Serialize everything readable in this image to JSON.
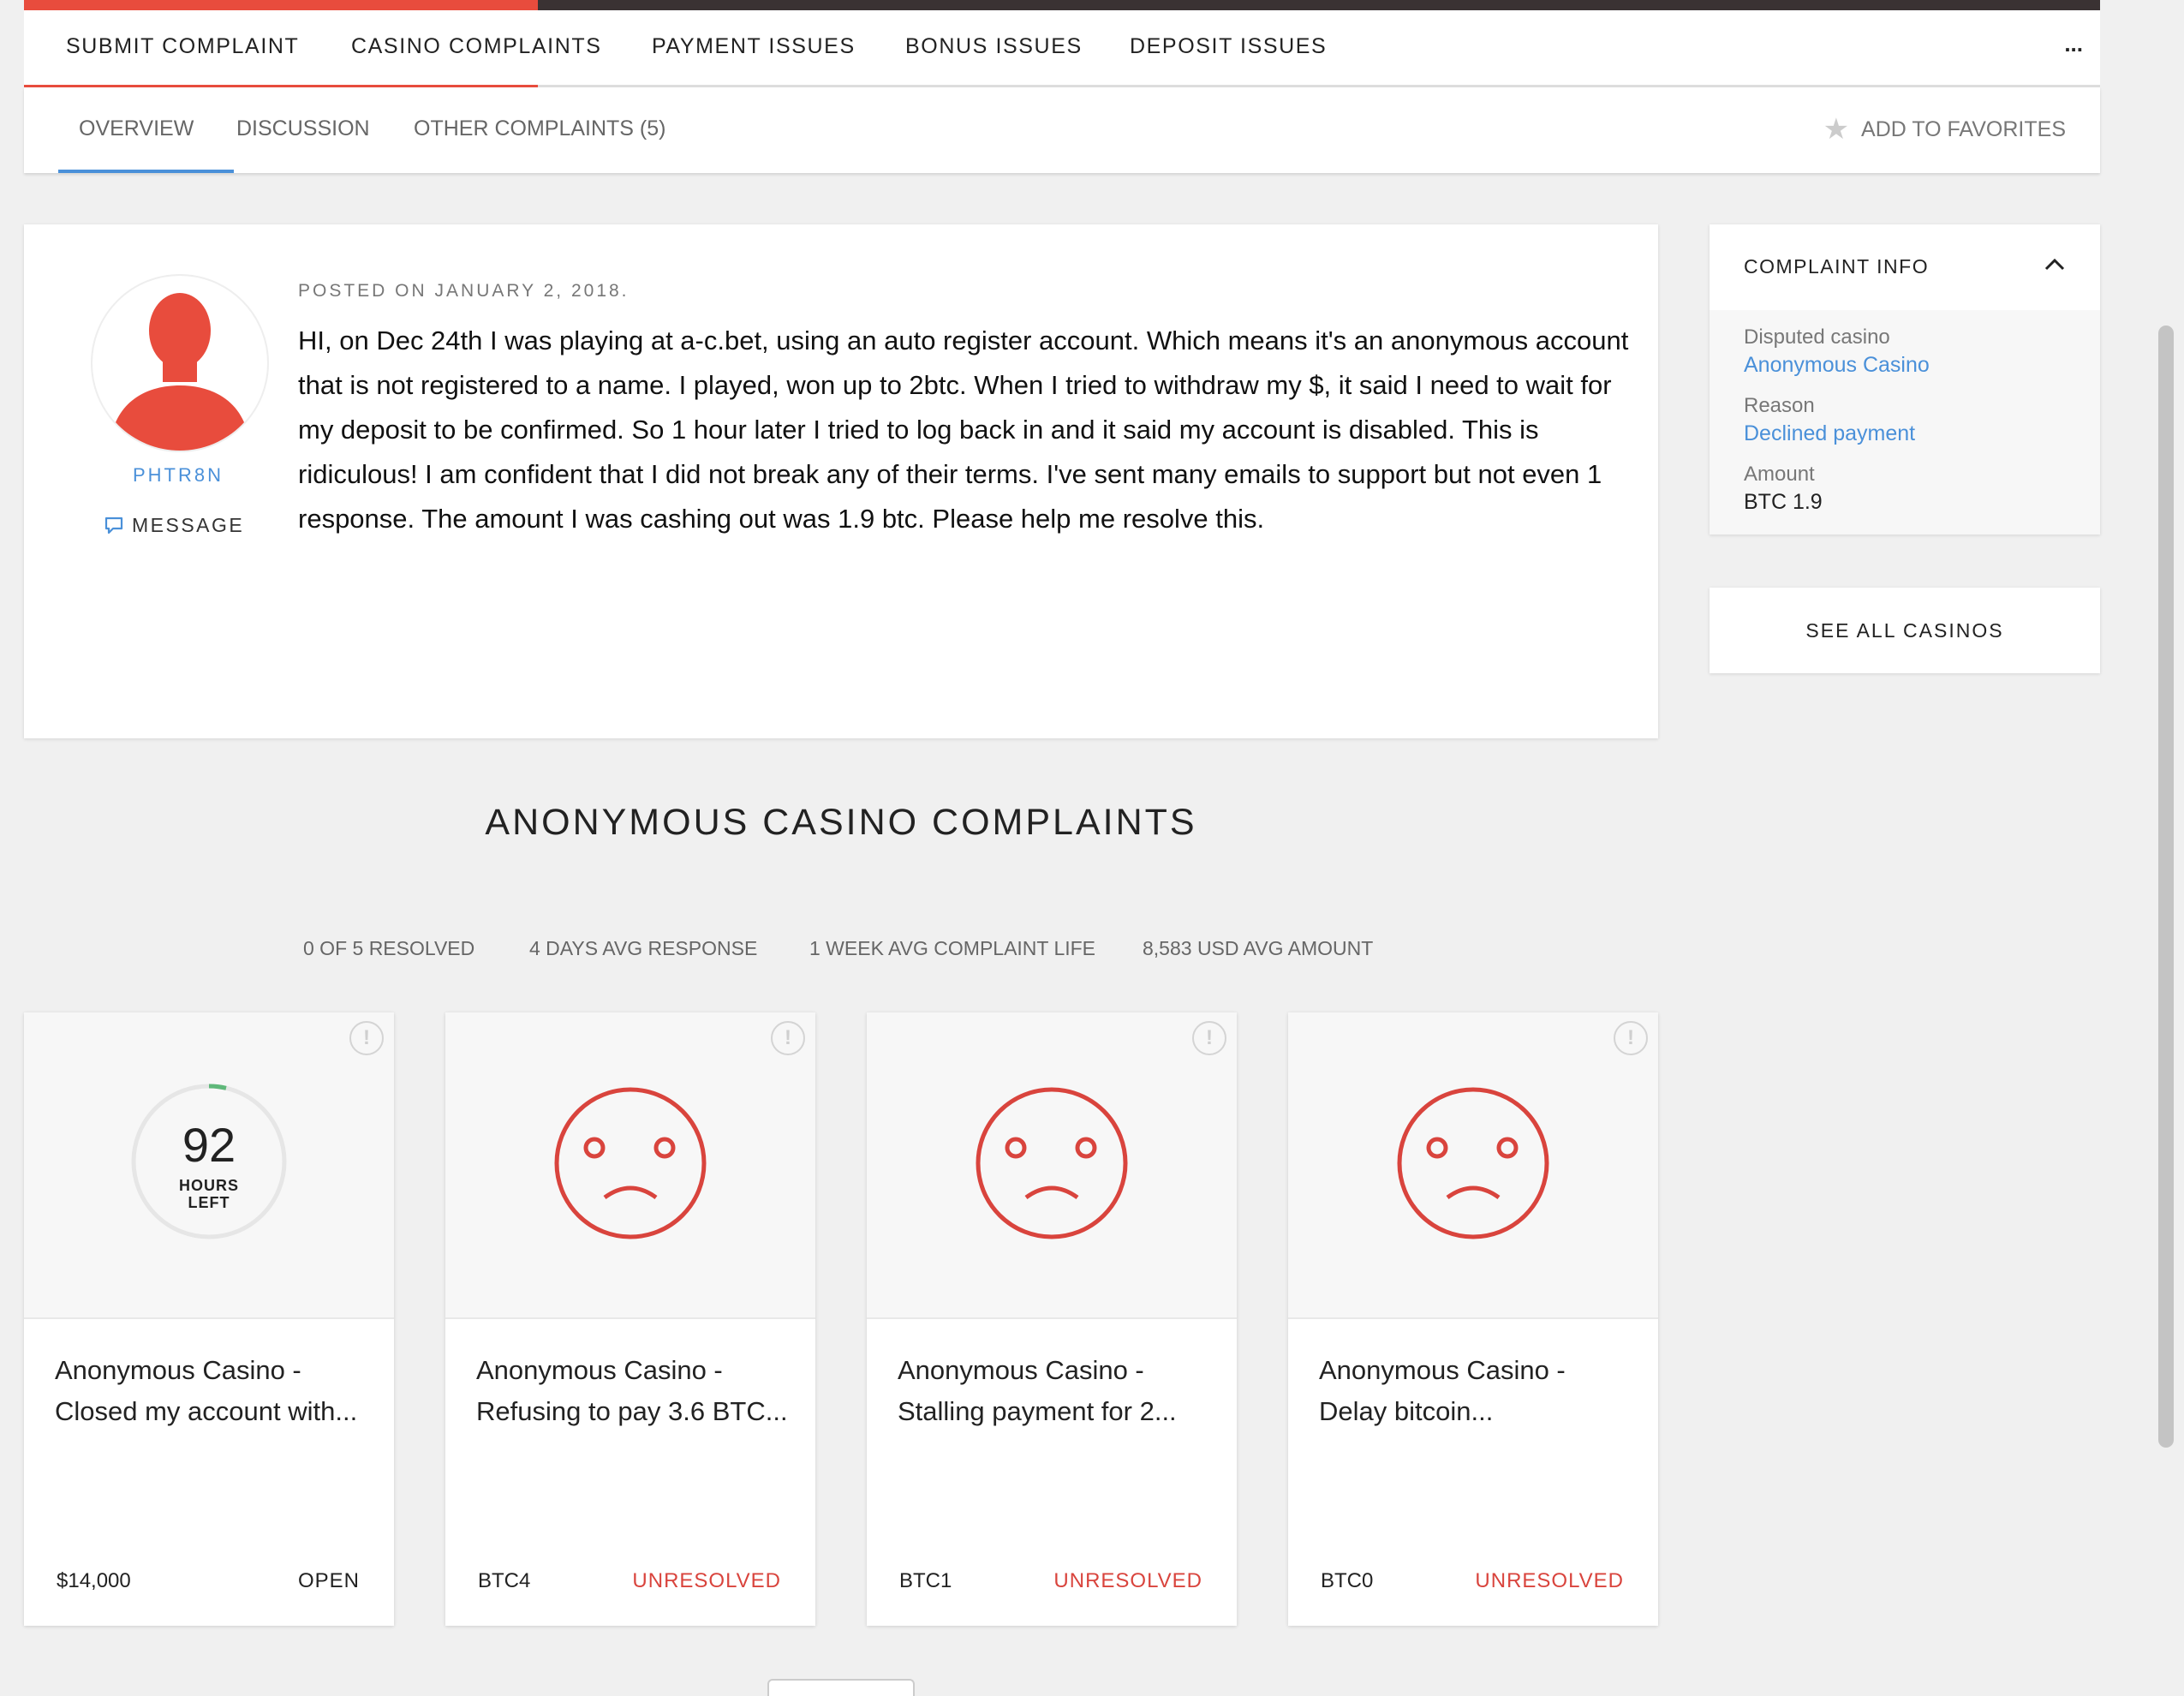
{
  "topnav": {
    "items": [
      "SUBMIT COMPLAINT",
      "CASINO COMPLAINTS",
      "PAYMENT ISSUES",
      "BONUS ISSUES",
      "DEPOSIT ISSUES"
    ],
    "more": "..."
  },
  "tabs": {
    "overview": "OVERVIEW",
    "discussion": "DISCUSSION",
    "other": "OTHER COMPLAINTS (5)",
    "favorites": "ADD TO FAVORITES"
  },
  "post": {
    "username": "PHTR8N",
    "message_label": "MESSAGE",
    "posted": "POSTED ON JANUARY 2, 2018.",
    "body": "HI, on Dec 24th I was playing at a-c.bet, using an auto register account. Which means it's an anonymous account that is not registered to a name. I played, won up to 2btc. When I tried to withdraw my $, it said I need to wait for my deposit to be confirmed. So 1 hour later I tried to log back in and it said my account is disabled. This is ridiculous! I am confident that I did not break any of their terms. I've sent many emails to support but not even 1 response. The amount I was cashing out was 1.9 btc. Please help me resolve this."
  },
  "info": {
    "title": "COMPLAINT INFO",
    "casino_label": "Disputed casino",
    "casino_value": "Anonymous Casino",
    "reason_label": "Reason",
    "reason_value": "Declined payment",
    "amount_label": "Amount",
    "amount_value": "BTC 1.9",
    "see_all": "SEE ALL CASINOS"
  },
  "section": {
    "title": "ANONYMOUS CASINO COMPLAINTS",
    "stats": [
      "0 OF 5 RESOLVED",
      "4 DAYS AVG RESPONSE",
      "1 WEEK AVG COMPLAINT LIFE",
      "8,583 USD AVG AMOUNT"
    ]
  },
  "cards": [
    {
      "title": "Anonymous Casino - Closed my account with...",
      "amount": "$14,000",
      "status": "OPEN",
      "timer_value": "92",
      "timer_label_1": "HOURS",
      "timer_label_2": "LEFT"
    },
    {
      "title": "Anonymous Casino - Refusing to pay 3.6 BTC...",
      "amount": "BTC4",
      "status": "UNRESOLVED"
    },
    {
      "title": "Anonymous Casino - Stalling payment for 2...",
      "amount": "BTC1",
      "status": "UNRESOLVED"
    },
    {
      "title": "Anonymous Casino - Delay bitcoin...",
      "amount": "BTC0",
      "status": "UNRESOLVED"
    }
  ],
  "warn_symbol": "!",
  "colors": {
    "accent_red": "#e84c3d",
    "link_blue": "#4a90d9",
    "status_red": "#d9443d",
    "dark_bar": "#3a3233"
  }
}
